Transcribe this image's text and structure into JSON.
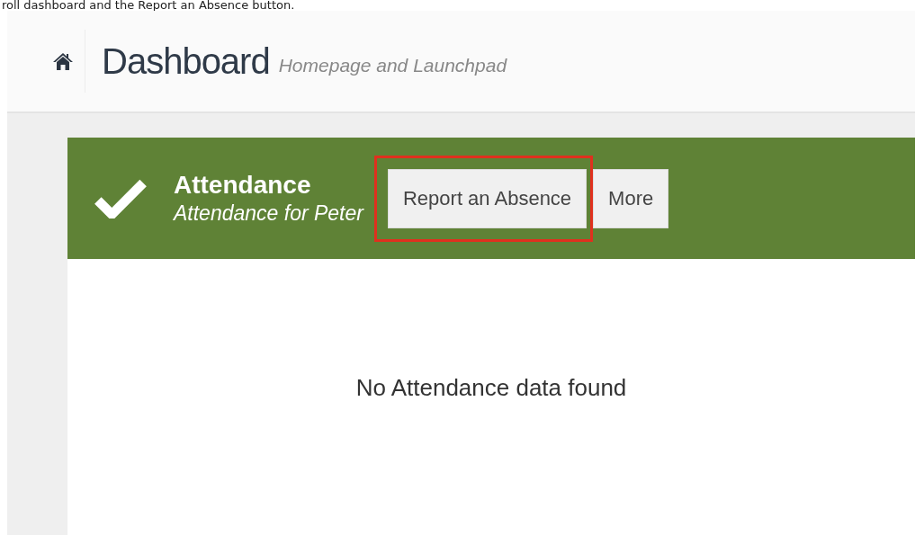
{
  "caption": "roll dashboard and the Report an Absence button.",
  "header": {
    "title": "Dashboard",
    "subtitle": "Homepage and Launchpad"
  },
  "card": {
    "title": "Attendance",
    "subtitle": "Attendance for Peter",
    "buttons": [
      {
        "label": "Report an Absence",
        "highlighted": true
      },
      {
        "label": "More",
        "highlighted": false
      }
    ],
    "message": "No Attendance data found"
  }
}
